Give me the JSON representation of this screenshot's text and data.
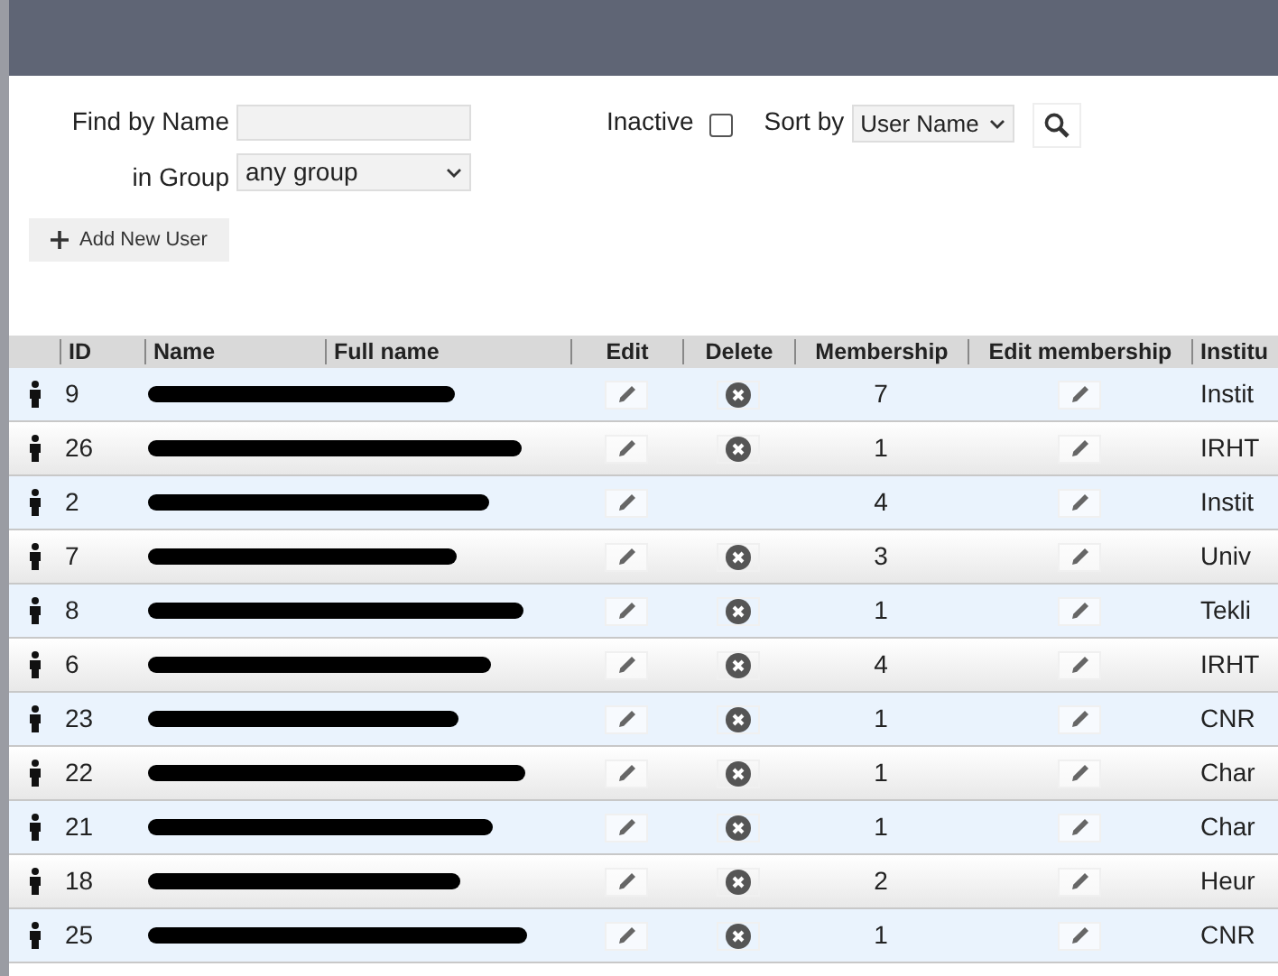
{
  "filters": {
    "find_label": "Find by Name",
    "group_label": "in Group",
    "group_value": "any group",
    "inactive_label": "Inactive",
    "inactive_checked": false,
    "sort_label": "Sort by",
    "sort_value": "User Name"
  },
  "add_button": "Add New User",
  "table": {
    "columns": [
      "ID",
      "Name",
      "Full name",
      "Edit",
      "Delete",
      "Membership",
      "Edit membership",
      "Institu"
    ],
    "rows": [
      {
        "id": "9",
        "deletable": true,
        "membership": "7",
        "institution": "Instit"
      },
      {
        "id": "26",
        "deletable": true,
        "membership": "1",
        "institution": "IRHT"
      },
      {
        "id": "2",
        "deletable": false,
        "membership": "4",
        "institution": "Instit"
      },
      {
        "id": "7",
        "deletable": true,
        "membership": "3",
        "institution": "Univ"
      },
      {
        "id": "8",
        "deletable": true,
        "membership": "1",
        "institution": "Tekli"
      },
      {
        "id": "6",
        "deletable": true,
        "membership": "4",
        "institution": "IRHT"
      },
      {
        "id": "23",
        "deletable": true,
        "membership": "1",
        "institution": "CNR"
      },
      {
        "id": "22",
        "deletable": true,
        "membership": "1",
        "institution": "Char"
      },
      {
        "id": "21",
        "deletable": true,
        "membership": "1",
        "institution": "Char"
      },
      {
        "id": "18",
        "deletable": true,
        "membership": "2",
        "institution": "Heur"
      },
      {
        "id": "25",
        "deletable": true,
        "membership": "1",
        "institution": "CNR"
      }
    ]
  }
}
